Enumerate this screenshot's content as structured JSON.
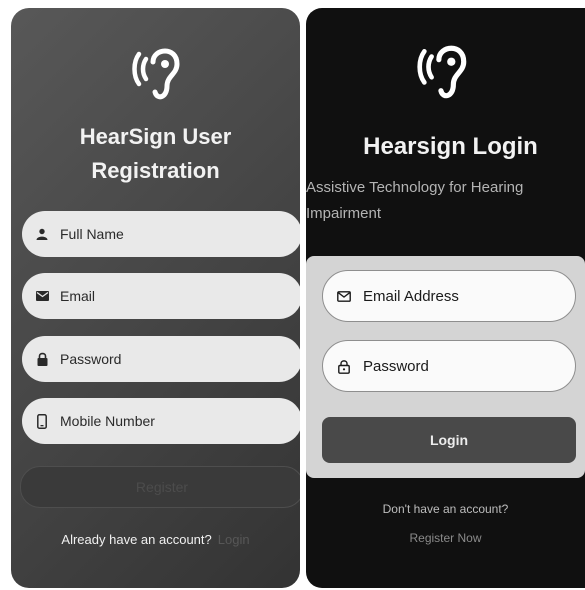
{
  "registration": {
    "title_line1": "HearSign User",
    "title_line2": "Registration",
    "fields": [
      {
        "label": "Full Name",
        "icon": "person-icon"
      },
      {
        "label": "Email",
        "icon": "mail-icon"
      },
      {
        "label": "Password",
        "icon": "lock-icon"
      },
      {
        "label": "Mobile Number",
        "icon": "phone-icon"
      }
    ],
    "register_button": "Register",
    "footer_prompt": "Already have an account?",
    "footer_link": "Login"
  },
  "login": {
    "title": "Hearsign Login",
    "subtitle_line1": "Assistive Technology for Hearing",
    "subtitle_line2": "Impairment",
    "fields": [
      {
        "label": "Email Address",
        "icon": "mail-icon"
      },
      {
        "label": "Password",
        "icon": "lock-icon"
      }
    ],
    "login_button": "Login",
    "footer_prompt": "Don't have an account?",
    "footer_link": "Register Now"
  },
  "colors": {
    "registration_bg": "#4a4a4a",
    "login_bg": "#101010",
    "field_bg": "#e9e9e9",
    "login_button_bg": "#494949"
  }
}
